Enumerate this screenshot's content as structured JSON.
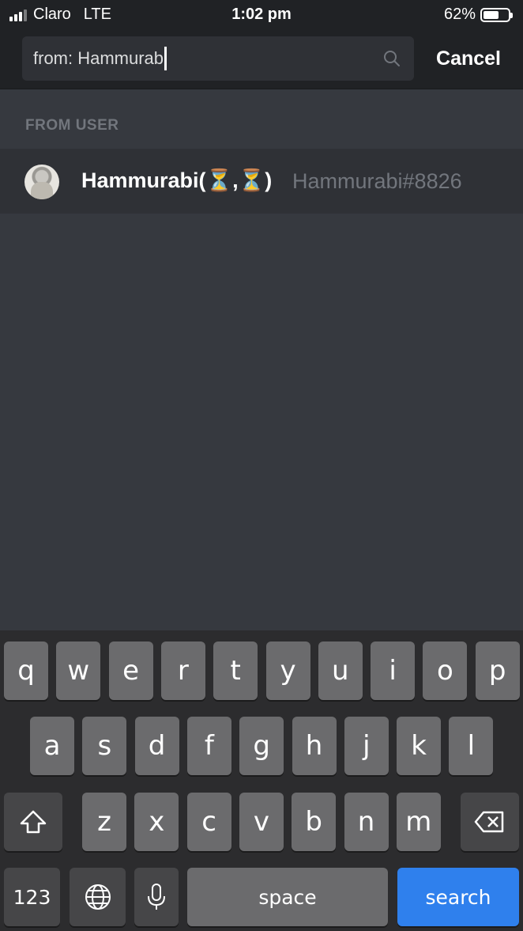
{
  "status_bar": {
    "carrier": "Claro",
    "network": "LTE",
    "time": "1:02 pm",
    "battery": "62%",
    "battery_level": 0.62
  },
  "search": {
    "value": "from: Hammurab",
    "cancel_label": "Cancel"
  },
  "section": {
    "label": "FROM USER"
  },
  "result": {
    "display_name": "Hammurabi(⏳,⏳)",
    "tag": "Hammurabi#8826"
  },
  "keyboard": {
    "row1": [
      "q",
      "w",
      "e",
      "r",
      "t",
      "y",
      "u",
      "i",
      "o",
      "p"
    ],
    "row2": [
      "a",
      "s",
      "d",
      "f",
      "g",
      "h",
      "j",
      "k",
      "l"
    ],
    "row3": [
      "z",
      "x",
      "c",
      "v",
      "b",
      "n",
      "m"
    ],
    "numbers": "123",
    "space": "space",
    "search": "search"
  },
  "colors": {
    "background": "#36393f",
    "header": "#202225",
    "accent": "#2f80ed"
  }
}
